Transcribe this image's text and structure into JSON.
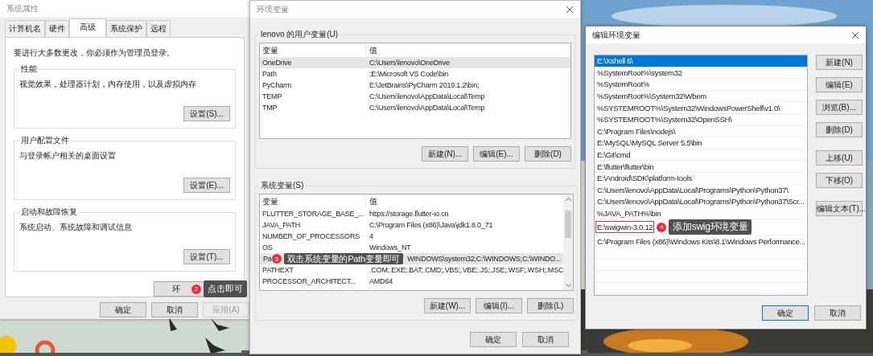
{
  "left_window": {
    "title": "系统属性",
    "tabs": [
      {
        "label": "计算机名",
        "selected": false
      },
      {
        "label": "硬件",
        "selected": false
      },
      {
        "label": "高级",
        "selected": true
      },
      {
        "label": "系统保护",
        "selected": false
      },
      {
        "label": "远程",
        "selected": false
      }
    ],
    "notice": "要进行大多数更改，你必须作为管理员登录。",
    "groups": [
      {
        "title": "性能",
        "description": "视觉效果，处理器计划，内存使用，以及虚拟内存",
        "button": "设置(S)..."
      },
      {
        "title": "用户配置文件",
        "description": "与登录帐户相关的桌面设置",
        "button": "设置(E)..."
      },
      {
        "title": "启动和故障恢复",
        "description": "系统启动、系统故障和调试信息",
        "button": "设置(T)..."
      }
    ],
    "env_button": {
      "label": "环",
      "annotation": {
        "number": "2",
        "text": "点击即可"
      }
    },
    "buttons": [
      {
        "label": "确定",
        "disabled": false
      },
      {
        "label": "取消",
        "disabled": false
      },
      {
        "label": "应用(A)",
        "disabled": true
      }
    ]
  },
  "middle_window": {
    "title": "环境变量",
    "user_vars": {
      "title": "lenovo 的用户变量(U)",
      "columns": [
        "变量",
        "值"
      ],
      "rows": [
        {
          "name": "OneDrive",
          "value": "C:\\Users\\lenovo\\OneDrive",
          "selected": true
        },
        {
          "name": "Path",
          "value": ";E:\\Microsoft VS Code\\bin",
          "selected": false
        },
        {
          "name": "PyCharm",
          "value": "E:\\JetBrains\\PyCharm 2019.1.2\\bin;",
          "selected": false
        },
        {
          "name": "TEMP",
          "value": "C:\\Users\\lenovo\\AppData\\Local\\Temp",
          "selected": false
        },
        {
          "name": "TMP",
          "value": "C:\\Users\\lenovo\\AppData\\Local\\Temp",
          "selected": false
        }
      ],
      "buttons": [
        "新建(N)...",
        "编辑(E)...",
        "删除(D)"
      ]
    },
    "system_vars": {
      "title": "系统变量(S)",
      "columns": [
        "变量",
        "值"
      ],
      "rows": [
        {
          "name": "FLUTTER_STORAGE_BASE_...",
          "value": "https://storage.flutter-io.cn",
          "selected": false
        },
        {
          "name": "JAVA_PATH",
          "value": "C:\\Program Files (x86)\\Java\\jdk1.8.0_71",
          "selected": false
        },
        {
          "name": "NUMBER_OF_PROCESSORS",
          "value": "4",
          "selected": false
        },
        {
          "name": "OS",
          "value": "Windows_NT",
          "selected": false
        },
        {
          "name": "Pa",
          "value": "WINDOWS\\system32;C:\\WINDOWS;C:\\WINDO...",
          "selected": true,
          "annotation": {
            "number": "3",
            "text": "双击系统变量的Path变量即可"
          }
        },
        {
          "name": "PATHEXT",
          "value": ".COM;.EXE;.BAT;.CMD;.VBS;.VBE;.JS;.JSE;.WSF;.WSH;.MSC",
          "selected": false
        },
        {
          "name": "PROCESSOR_ARCHITECT...",
          "value": "AMD64",
          "selected": false
        }
      ],
      "buttons": [
        "新建(W)...",
        "编辑(I)...",
        "删除(L)"
      ]
    },
    "buttons": [
      "确定",
      "取消"
    ]
  },
  "right_window": {
    "title": "编辑环境变量",
    "entries": [
      {
        "text": "E:\\Xshell 6\\",
        "selected": true,
        "outlined": false
      },
      {
        "text": "%SystemRoot%\\system32",
        "selected": false,
        "outlined": false
      },
      {
        "text": "%SystemRoot%",
        "selected": false,
        "outlined": false
      },
      {
        "text": "%SystemRoot%\\System32\\Wbem",
        "selected": false,
        "outlined": false
      },
      {
        "text": "%SYSTEMROOT%\\System32\\WindowsPowerShell\\v1.0\\",
        "selected": false,
        "outlined": false
      },
      {
        "text": "%SYSTEMROOT%\\System32\\OpenSSH\\",
        "selected": false,
        "outlined": false
      },
      {
        "text": "C:\\Program Files\\nodejs\\",
        "selected": false,
        "outlined": false
      },
      {
        "text": "E:\\MySQL\\MySQL Server 5.5\\bin",
        "selected": false,
        "outlined": false
      },
      {
        "text": "E:\\Git\\cmd",
        "selected": false,
        "outlined": false
      },
      {
        "text": "E:\\flutter\\flutter\\bin",
        "selected": false,
        "outlined": false
      },
      {
        "text": "E:\\Android\\SDK\\platform-tools",
        "selected": false,
        "outlined": false
      },
      {
        "text": "C:\\Users\\lenovo\\AppData\\Local\\Programs\\Python\\Python37\\",
        "selected": false,
        "outlined": false
      },
      {
        "text": "C:\\Users\\lenovo\\AppData\\Local\\Programs\\Python\\Python37\\Scr...",
        "selected": false,
        "outlined": false
      },
      {
        "text": "%JAVA_PATH%\\bin",
        "selected": false,
        "outlined": false
      },
      {
        "text": "E:\\swigwin-3.0.12",
        "selected": false,
        "outlined": true,
        "annotation": {
          "number": "4",
          "text": "添加swig环境变量"
        }
      },
      {
        "text": "C:\\Program Files (x86)\\Windows Kits\\8.1\\Windows Performance...",
        "selected": false,
        "outlined": false
      }
    ],
    "button_groups": [
      [
        "新建(N)",
        "编辑(E)",
        "浏览(B)...",
        "删除(D)"
      ],
      [
        "上移(U)",
        "下移(O)"
      ],
      [
        "编辑文本(T)..."
      ]
    ],
    "buttons": [
      "确定",
      "取消"
    ]
  }
}
